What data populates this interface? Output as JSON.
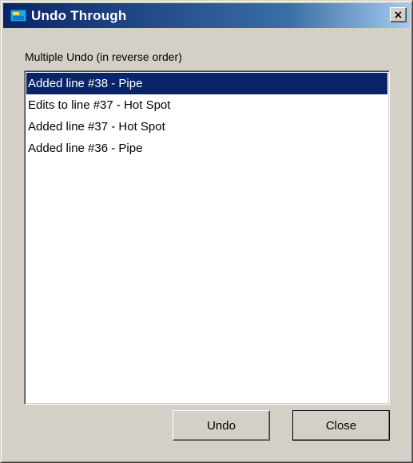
{
  "window": {
    "title": "Undo Through",
    "app_icon": "app-window-icon",
    "close_glyph": "×"
  },
  "caption": "Multiple Undo (in reverse order)",
  "list": {
    "items": [
      {
        "label": "Added line #38 - Pipe",
        "selected": true
      },
      {
        "label": "Edits to line #37 - Hot Spot",
        "selected": false
      },
      {
        "label": "Added line #37 - Hot Spot",
        "selected": false
      },
      {
        "label": "Added line #36 - Pipe",
        "selected": false
      }
    ]
  },
  "buttons": {
    "undo": "Undo",
    "close": "Close"
  },
  "colors": {
    "selection": "#0a246a",
    "titlebar_start": "#0a246a",
    "titlebar_end": "#a6caf0",
    "face": "#d4d0c8"
  }
}
